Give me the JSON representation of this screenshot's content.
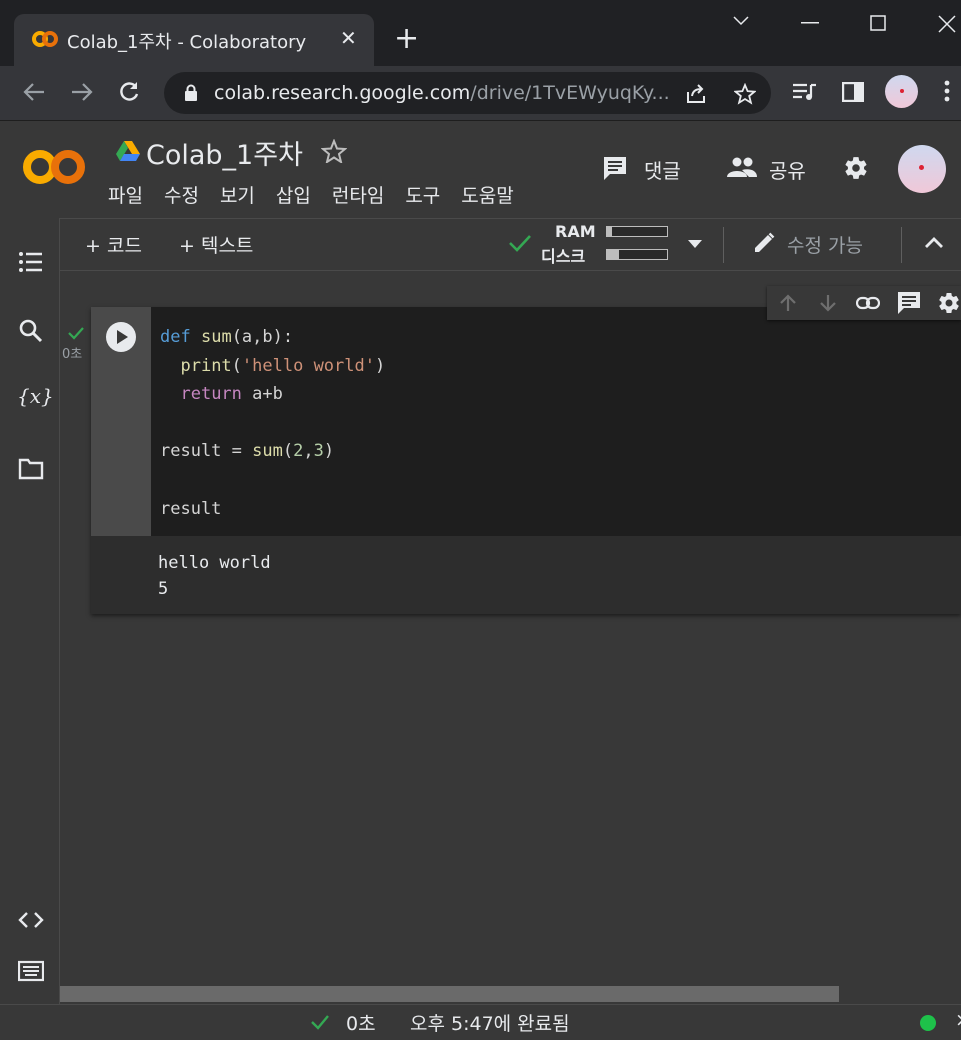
{
  "browser": {
    "tab_title": "Colab_1주차 - Colaboratory",
    "tab_close": "✕",
    "new_tab": "+",
    "url_host": "colab.research.google.com",
    "url_path": "/drive/1TvEWyuqKy..."
  },
  "header": {
    "notebook_title": "Colab_1주차",
    "menu": [
      "파일",
      "수정",
      "보기",
      "삽입",
      "런타임",
      "도구",
      "도움말"
    ],
    "comment_label": "댓글",
    "share_label": "공유"
  },
  "toolbar": {
    "add_code": "+ 코드",
    "add_text": "+ 텍스트",
    "ram_label": "RAM",
    "disk_label": "디스크",
    "ram_usage": 0.08,
    "disk_usage": 0.2,
    "edit_mode": "수정 가능"
  },
  "cell": {
    "exec_time": "0초",
    "code_lines": [
      "def sum(a,b):",
      "  print('hello world')",
      "  return a+b",
      "",
      "result = sum(2,3)",
      "",
      "result"
    ],
    "output": [
      "hello world",
      "5"
    ]
  },
  "status": {
    "time": "0초",
    "completed": "오후 5:47에 완료됨"
  },
  "colors": {
    "accent_green": "#34a853",
    "colab_orange": "#f9ab00",
    "colab_dark_orange": "#e8710a"
  }
}
